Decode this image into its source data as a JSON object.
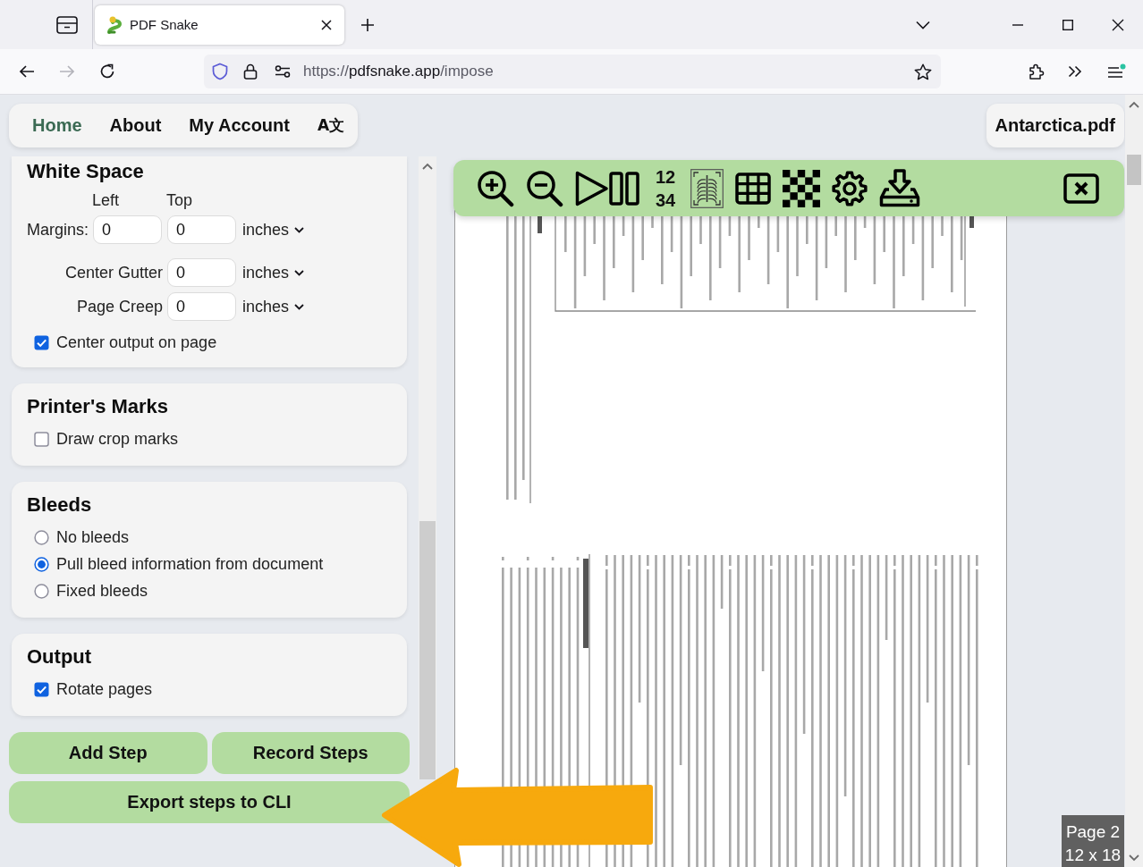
{
  "browser": {
    "tabs": [
      {
        "title": "PDF Snake",
        "selected": true
      }
    ],
    "address": {
      "scheme": "https://",
      "host": "pdfsnake.app",
      "path": "/impose"
    },
    "forward_disabled": true
  },
  "nav": {
    "items": [
      {
        "label": "Home",
        "selected": true
      },
      {
        "label": "About",
        "selected": false
      },
      {
        "label": "My Account",
        "selected": false
      }
    ],
    "language_button": "A文"
  },
  "sections": [
    {
      "title": "White Space",
      "controls": [
        {
          "kind": "headings",
          "labels": [
            "Left",
            "Top"
          ]
        },
        {
          "kind": "fields",
          "label": "Margins:",
          "values": [
            "0",
            "0"
          ],
          "unit": "inches"
        },
        {
          "kind": "fields",
          "label": "Center Gutter",
          "values": [
            "0"
          ],
          "unit": "inches"
        },
        {
          "kind": "fields",
          "label": "Page Creep",
          "values": [
            "0"
          ],
          "unit": "inches"
        },
        {
          "kind": "checkbox",
          "label": "Center output on page",
          "checked": true
        }
      ]
    },
    {
      "title": "Printer's Marks",
      "controls": [
        {
          "kind": "checkbox",
          "label": "Draw crop marks",
          "checked": false
        }
      ]
    },
    {
      "title": "Bleeds",
      "controls": [
        {
          "kind": "radio",
          "label": "No bleeds",
          "selected": false
        },
        {
          "kind": "radio",
          "label": "Pull bleed information from document",
          "selected": true
        },
        {
          "kind": "radio",
          "label": "Fixed bleeds",
          "selected": false
        }
      ]
    },
    {
      "title": "Output",
      "controls": [
        {
          "kind": "checkbox",
          "label": "Rotate pages",
          "checked": true
        }
      ]
    }
  ],
  "actions": [
    {
      "label": "Add Step"
    },
    {
      "label": "Record Steps"
    },
    {
      "label": "Export steps to CLI"
    }
  ],
  "preview": {
    "file_name": "Antarctica.pdf",
    "toolbar": {
      "page_order": [
        "12",
        "34"
      ]
    },
    "page_indicator": [
      "Page 2",
      "12 x 18"
    ]
  }
}
